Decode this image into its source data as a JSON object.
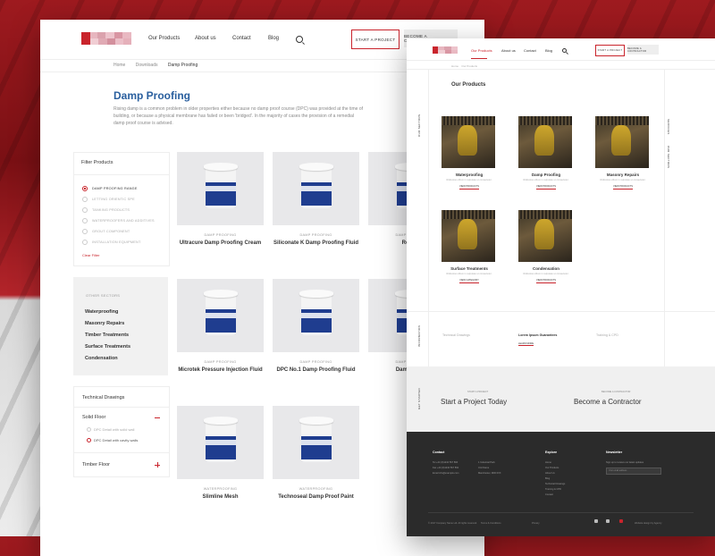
{
  "left": {
    "nav": {
      "links": [
        "Our Products",
        "About us",
        "Contact",
        "Blog"
      ],
      "start_project": "START A PROJECT",
      "become_contractor": "BECOME A CONTRACTOR"
    },
    "breadcrumb": [
      "Home",
      "Downloads",
      "Damp Proofing"
    ],
    "title": "Damp Proofing",
    "intro": "Rising damp is a common problem in older properties either because no damp proof course (DPC) was provided at the time of building, or because a physical membrane has failed or been 'bridged'. In the majority of cases the provision of a remedial damp proof course is advised.",
    "filter": {
      "title": "Filter Products",
      "items": [
        "DAMP PROOFING RANGE",
        "LETTING ORIENTIC SPE",
        "TANKING PRODUCTS",
        "WATERPROOFERS AND ADDITIVES",
        "GROUT COMPONENT",
        "INSTALLATION EQUIPMENT"
      ],
      "clear": "Clear Filter"
    },
    "sectors": {
      "label": "OTHER SECTORS",
      "items": [
        "Waterproofing",
        "Masonry Repairs",
        "Timber Treatments",
        "Surface Treatments",
        "Condensation"
      ]
    },
    "tech": {
      "title": "Technical Drawings",
      "group1": "Solid Floor",
      "sub": [
        "DPC Detail with solid wall",
        "DPC Detail with cavity walls"
      ],
      "group2": "Timber Floor"
    },
    "products": [
      {
        "cat": "DAMP PROOFING",
        "name": "Ultracure Damp Proofing Cream"
      },
      {
        "cat": "DAMP PROOFING",
        "name": "Siliconate K Damp Proofing Fluid"
      },
      {
        "cat": "DAMP PROOFING",
        "name": "Renova"
      },
      {
        "cat": "DAMP PROOFING",
        "name": "Microtek Pressure Injection Fluid"
      },
      {
        "cat": "DAMP PROOFING",
        "name": "DPC No.1 Damp Proofing Fluid"
      },
      {
        "cat": "DAMP PROOFING",
        "name": "Dampstop N"
      },
      {
        "cat": "WATERPROOFING",
        "name": "Slimline Mesh"
      },
      {
        "cat": "WATERPROOFING",
        "name": "Technoseal Damp Proof Paint"
      }
    ]
  },
  "right": {
    "nav": {
      "links": [
        "Our Products",
        "About us",
        "Contact",
        "Blog"
      ],
      "start_project": "START A PROJECT",
      "become_contractor": "BECOME A CONTRACTOR"
    },
    "breadcrumb": [
      "Home",
      "Our Products"
    ],
    "title": "Our Products",
    "side_left": "OUR SECTORS",
    "side_right": [
      "SERVICES",
      "OUR SECTORS"
    ],
    "cards": [
      {
        "name": "Waterproofing",
        "desc": "Ridiculous cillum in vulputate ut consectetur.",
        "link": "VIEW PRODUCTS"
      },
      {
        "name": "Damp Proofing",
        "desc": "Ridiculous cillum in vulputate ut consectetur.",
        "link": "VIEW PRODUCTS"
      },
      {
        "name": "Masonry Repairs",
        "desc": "Ridiculous cillum in vulputate ut consectetur.",
        "link": "VIEW PRODUCTS"
      },
      {
        "name": "Surface Treatments",
        "desc": "Ridiculous cillum in vulputate ut consectetur.",
        "link": "VIEW CATEGORY"
      },
      {
        "name": "Condensation",
        "desc": "Ridiculous cillum in vulputate ut consectetur.",
        "link": "VIEW PRODUCTS"
      }
    ],
    "tabs": [
      "Technical Drawings",
      "Lorem Ipsum Guarantees",
      "Training & CPD"
    ],
    "tabs_side": "INFORMATION",
    "learn_more": "LEARN MORE",
    "cta": {
      "side": "GET STARTED",
      "left_small": "START A PROJECT",
      "left_big": "Start a Project Today",
      "right_small": "BECOME A CONTRACTOR",
      "right_big": "Become a Contractor"
    },
    "footer": {
      "contact_h": "Contact",
      "contact_lines": [
        "Tel   +44 (0)1234 567 890",
        "Fax   +44 (0)1234 567 891",
        "Email  info@example.com"
      ],
      "addr_lines": [
        "1 Industrial Park",
        "Unit Name",
        "Manchester, M00 0XX"
      ],
      "explore_h": "Explore",
      "explore": [
        "Home",
        "Our Products",
        "About Us",
        "Blog",
        "Technical Drawings",
        "Training & CPD",
        "Contact"
      ],
      "news_h": "Newsletter",
      "news_text": "Sign up to receive our latest updates",
      "news_placeholder": "Your email address",
      "copyright": "© 2017 Company Name Ltd. All rights reserved.",
      "legal": [
        "Terms & Conditions",
        "Privacy"
      ],
      "credit": "Website design by Agency"
    }
  }
}
